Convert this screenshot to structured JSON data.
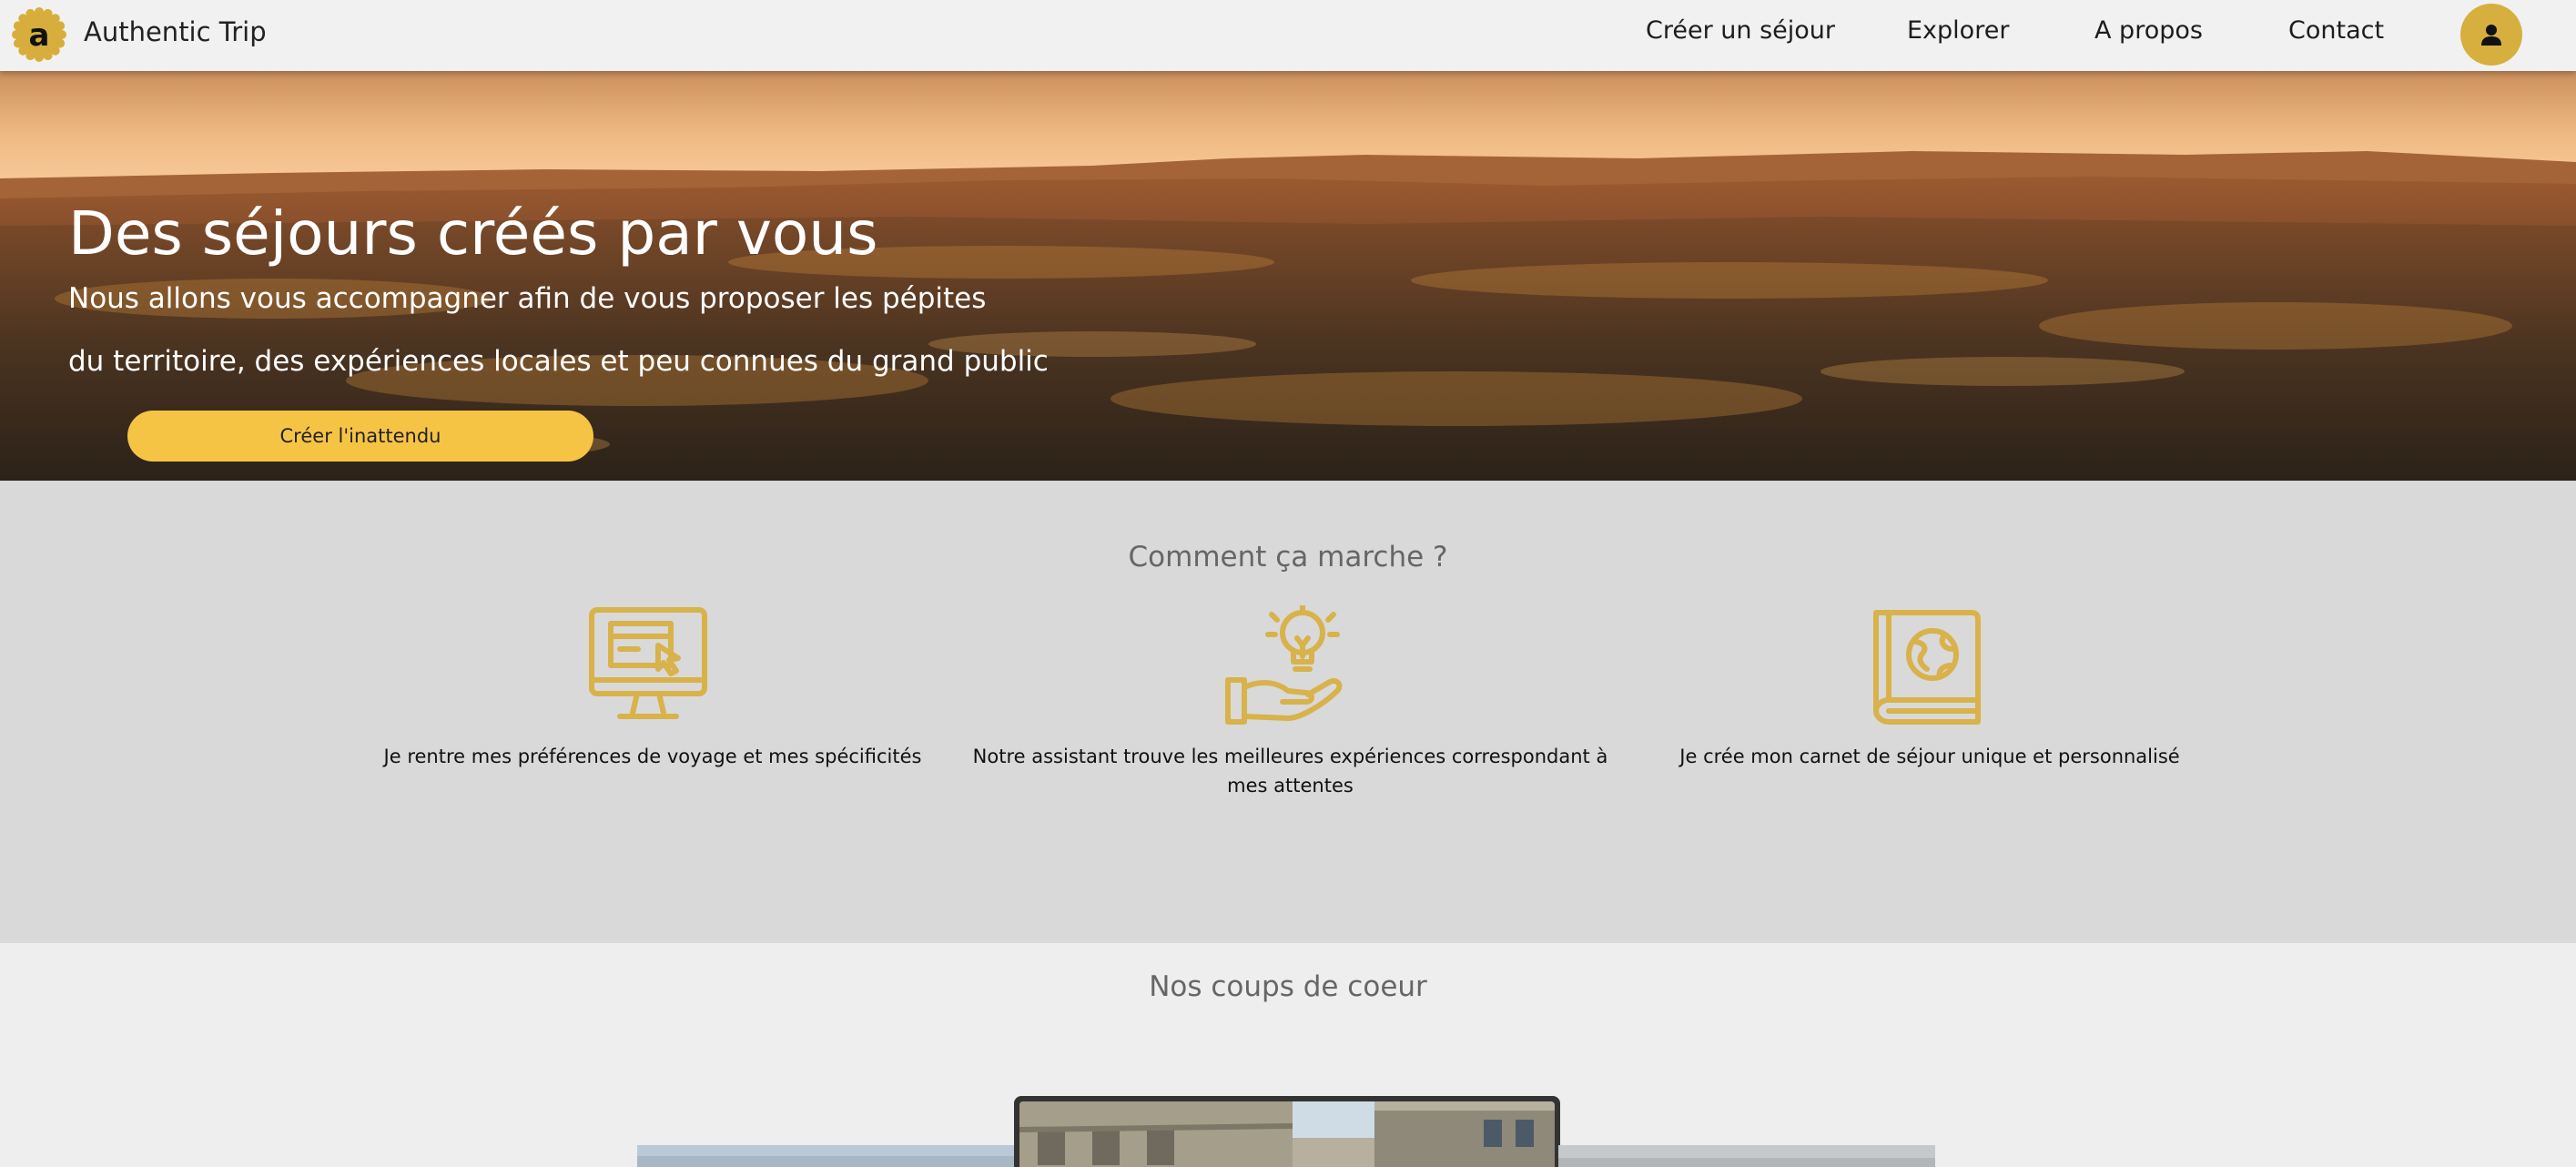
{
  "navbar": {
    "brand": "Authentic Trip",
    "logo_letter": "a",
    "links": [
      "Créer un séjour",
      "Explorer",
      "A propos",
      "Contact"
    ],
    "avatar_icon": "user-icon"
  },
  "hero": {
    "title": "Des séjours créés par vous",
    "subtitle_line1": "Nous allons vous accompagner afin de vous proposer les pépites",
    "subtitle_line2": "du territoire, des expériences locales et peu connues du grand public",
    "cta_label": "Créer l'inattendu"
  },
  "how_it_works": {
    "title": "Comment ça marche ?",
    "steps": [
      {
        "icon": "computer-screen-icon",
        "text": "Je rentre mes préférences de voyage et mes spécificités"
      },
      {
        "icon": "lightbulb-hand-icon",
        "text_line1": "Notre assistant trouve les meilleures expériences correspondant à",
        "text_line2": "mes attentes"
      },
      {
        "icon": "globe-book-icon",
        "text": "Je crée mon carnet de séjour unique et personnalisé"
      }
    ]
  },
  "favorites": {
    "title": "Nos coups de coeur"
  },
  "colors": {
    "accent": "#d6af3f",
    "cta": "#f6c445",
    "icon_gold": "#d8b24a",
    "section_grey": "#d9d9d9",
    "page_bg": "#eeeeee"
  }
}
